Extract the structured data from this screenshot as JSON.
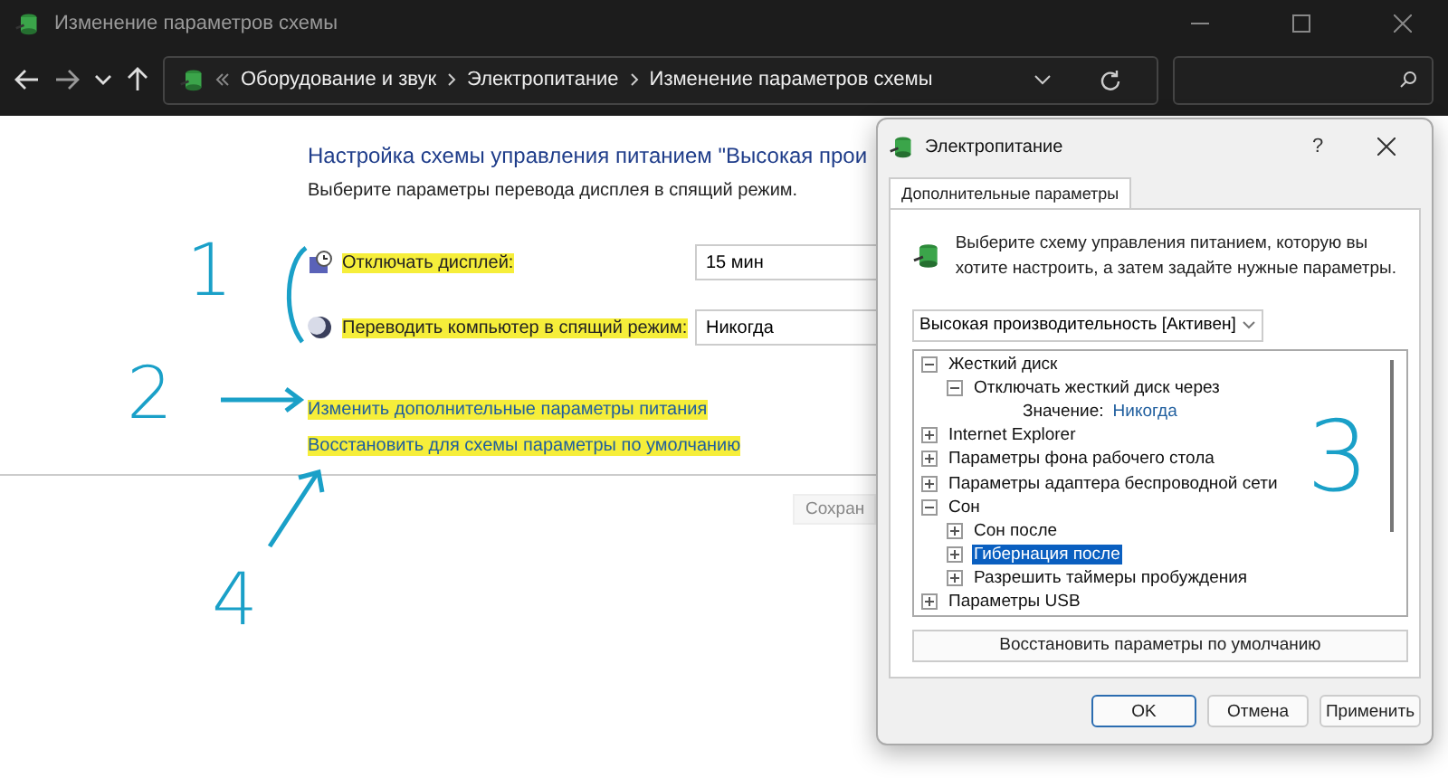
{
  "window": {
    "title": "Изменение параметров схемы"
  },
  "breadcrumb": [
    "Оборудование и звук",
    "Электропитание",
    "Изменение параметров схемы"
  ],
  "main": {
    "title": "Настройка схемы управления питанием \"Высокая прои",
    "subtitle": "Выберите параметры перевода дисплея в спящий режим.",
    "settings": [
      {
        "kind": "display",
        "label": "Отключать дисплей:",
        "value": "15 мин",
        "highlighted": true
      },
      {
        "kind": "sleep",
        "label": "Переводить компьютер в спящий режим:",
        "value": "Никогда",
        "highlighted": true
      }
    ],
    "links": [
      {
        "label": "Изменить дополнительные параметры питания",
        "highlighted": true
      },
      {
        "label": "Восстановить для схемы параметры по умолчанию",
        "highlighted": true
      }
    ],
    "save_button": "Сохран"
  },
  "annotations": [
    "1",
    "2",
    "3",
    "4"
  ],
  "dialog": {
    "title": "Электропитание",
    "help": "?",
    "tab": {
      "label": "Дополнительные параметры",
      "selected": true
    },
    "description": "Выберите схему управления питанием, которую вы хотите настроить, а затем задайте нужные параметры.",
    "scheme": "Высокая производительность [Активен]",
    "tree": [
      {
        "label": "Жесткий диск",
        "expanded": true,
        "selected": false,
        "children": [
          {
            "label": "Отключать жесткий диск через",
            "expanded": true,
            "selected": false,
            "value_label": "Значение:",
            "value": "Никогда"
          }
        ]
      },
      {
        "label": "Internet Explorer",
        "expanded": false,
        "selected": false
      },
      {
        "label": "Параметры фона рабочего стола",
        "expanded": false,
        "selected": false
      },
      {
        "label": "Параметры адаптера беспроводной сети",
        "expanded": false,
        "selected": false
      },
      {
        "label": "Сон",
        "expanded": true,
        "selected": false,
        "children": [
          {
            "label": "Сон после",
            "expanded": false,
            "selected": false
          },
          {
            "label": "Гибернация после",
            "expanded": false,
            "selected": true
          },
          {
            "label": "Разрешить таймеры пробуждения",
            "expanded": false,
            "selected": false
          }
        ]
      },
      {
        "label": "Параметры USB",
        "expanded": false,
        "selected": false
      }
    ],
    "restore_button": "Восстановить параметры по умолчанию",
    "buttons": [
      {
        "label": "OK",
        "kind": "default"
      },
      {
        "label": "Отмена",
        "kind": "normal"
      },
      {
        "label": "Применить",
        "kind": "normal"
      }
    ]
  }
}
